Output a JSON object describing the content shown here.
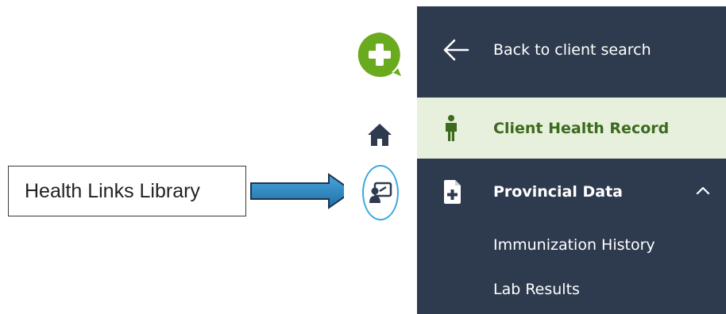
{
  "annotation": {
    "callout_text": "Health Links Library",
    "arrow_color": "#2f8fc7"
  },
  "rail": {
    "logo_icon": "health-plus-chat-logo",
    "home_icon": "home-icon",
    "links_icon": "presentation-board-icon",
    "highlight_color": "#3da8e0"
  },
  "nav": {
    "back_label": "Back to client search",
    "active_item_label": "Client Health Record",
    "section_label": "Provincial Data",
    "section_expanded": true,
    "sub_items": [
      {
        "label": "Immunization History"
      },
      {
        "label": "Lab Results"
      }
    ]
  },
  "colors": {
    "panel_bg": "#2e3b4e",
    "active_bg": "#e7f0dc",
    "active_text": "#3c6a1e",
    "brand_green": "#6aaa1f"
  }
}
